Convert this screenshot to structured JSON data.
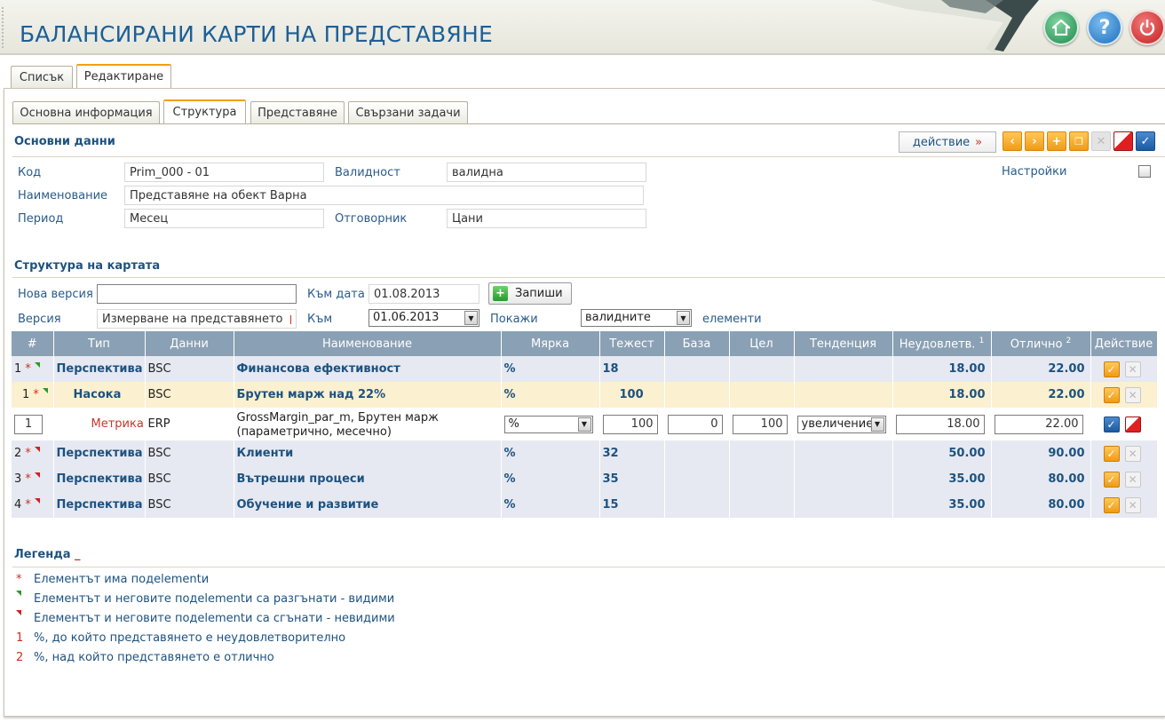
{
  "header": {
    "title": "БАЛАНСИРАНИ КАРТИ НА ПРЕДСТАВЯНЕ"
  },
  "top_tabs": [
    {
      "label": "Списък"
    },
    {
      "label": "Редактиране"
    }
  ],
  "sub_tabs": [
    {
      "label": "Основна информация"
    },
    {
      "label": "Структура"
    },
    {
      "label": "Представяне"
    },
    {
      "label": "Свързани задачи"
    }
  ],
  "basic": {
    "title": "Основни данни",
    "action_label": "действие",
    "action_arrows": "»",
    "code_label": "Код",
    "code_value": "Prim_000 - 01",
    "validity_label": "Валидност",
    "validity_value": "валидна",
    "name_label": "Наименование",
    "name_value": "Представяне на обект Варна",
    "period_label": "Период",
    "period_value": "Месец",
    "owner_label": "Отговорник",
    "owner_value": "Цани",
    "settings_label": "Настройки"
  },
  "structure": {
    "title": "Структура на картата",
    "new_version_label": "Нова версия",
    "new_version_value": "",
    "to_date_label": "Към дата",
    "to_date_value": "01.08.2013",
    "save_label": "Запиши",
    "version_label": "Версия",
    "version_value": "Измерване на представянето",
    "to_label": "Към",
    "to_value": "01.06.2013",
    "show_label": "Покажи",
    "show_value": "валидните",
    "elements_label": "елементи"
  },
  "grid": {
    "columns": [
      "#",
      "Тип",
      "Данни",
      "Наименование",
      "Мярка",
      "Тежест",
      "База",
      "Цел",
      "Тенденция",
      "Неудовлетв.",
      "Отлично",
      "Действие"
    ],
    "sup1": "1",
    "sup2": "2",
    "rows": [
      {
        "num": "1",
        "type": "Перспектива",
        "data": "BSC",
        "name": "Финансова ефективност",
        "measure": "%",
        "weight": "18",
        "poor": "18.00",
        "excellent": "22.00"
      },
      {
        "num": "1",
        "type": "Насока",
        "data": "BSC",
        "name": "Брутен марж над 22%",
        "measure": "%",
        "weight": "100",
        "poor": "18.00",
        "excellent": "22.00"
      },
      {
        "num": "1",
        "type": "Метрика",
        "data": "ERP",
        "name_line1": "GrossMargin_par_m, Брутен марж",
        "name_line2": "(параметрично, месечно)",
        "measure": "%",
        "weight": "100",
        "base": "0",
        "target": "100",
        "trend": "увеличение",
        "poor": "18.00",
        "excellent": "22.00"
      },
      {
        "num": "2",
        "type": "Перспектива",
        "data": "BSC",
        "name": "Клиенти",
        "measure": "%",
        "weight": "32",
        "poor": "50.00",
        "excellent": "90.00"
      },
      {
        "num": "3",
        "type": "Перспектива",
        "data": "BSC",
        "name": "Вътрешни процеси",
        "measure": "%",
        "weight": "35",
        "poor": "35.00",
        "excellent": "80.00"
      },
      {
        "num": "4",
        "type": "Перспектива",
        "data": "BSC",
        "name": "Обучение и развитие",
        "measure": "%",
        "weight": "15",
        "poor": "35.00",
        "excellent": "80.00"
      }
    ]
  },
  "legend": {
    "title": "Легенда",
    "title_suffix": "_",
    "items": [
      {
        "mark": "*",
        "text": "Елементът има подelementи"
      },
      {
        "mark": "",
        "text": "Елементът и неговите подelementи са разгънати - видими"
      },
      {
        "mark": "",
        "text": "Елементът и неговите подelementи са сгънати - невидими"
      },
      {
        "mark": "1",
        "text": "%, до който представянето е неудовлетворително"
      },
      {
        "mark": "2",
        "text": "%, над който представянето е отлично"
      }
    ]
  },
  "colors": {
    "accent": "#1d5280",
    "header_row": "#8aa0b4",
    "orange": "#f29a12"
  },
  "icons": [
    "home-icon",
    "help-icon",
    "power-icon",
    "prev-icon",
    "next-icon",
    "add-icon",
    "copy-icon",
    "close-icon",
    "cancel-icon",
    "confirm-icon",
    "edit-icon",
    "delete-icon",
    "plus-icon",
    "checkbox-icon"
  ]
}
